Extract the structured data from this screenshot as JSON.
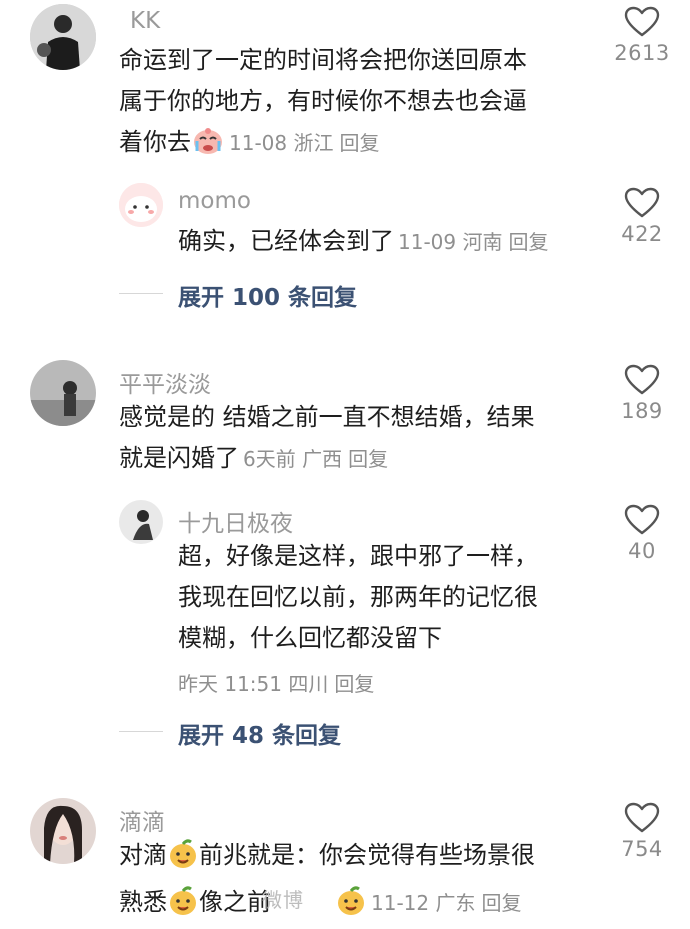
{
  "comments": [
    {
      "user": "KK",
      "text_lines": [
        "命运到了一定的时间将会把你送回原本",
        "属于你的地方，有时候你不想去也会逼",
        "着你去"
      ],
      "date": "11-08",
      "location": "浙江",
      "reply_label": "回复",
      "likes": "2613",
      "emoji": "crying-face",
      "replies": [
        {
          "user": "momo",
          "text": "确实，已经体会到了",
          "date": "11-09",
          "location": "河南",
          "reply_label": "回复",
          "likes": "422"
        }
      ],
      "expand_label": "展开 100 条回复"
    },
    {
      "user": "平平淡淡",
      "text_lines": [
        "感觉是的 结婚之前一直不想结婚，结果",
        "就是闪婚了"
      ],
      "date": "6天前",
      "location": "广西",
      "reply_label": "回复",
      "likes": "189",
      "replies": [
        {
          "user": "十九日极夜",
          "text_lines": [
            "超，好像是这样，跟中邪了一样，",
            "我现在回忆以前，那两年的记忆很",
            "模糊，什么回忆都没留下"
          ],
          "date": "昨天 11:51",
          "location": "四川",
          "reply_label": "回复",
          "likes": "40"
        }
      ],
      "expand_label": "展开 48 条回复"
    },
    {
      "user": "滴滴",
      "text_line1_a": "对滴",
      "text_line1_b": "前兆就是：你会觉得有些场景很",
      "text_line2_a": "熟悉",
      "text_line2_b": "像之前",
      "date": "11-12",
      "location": "广东",
      "reply_label": "回复",
      "likes": "754",
      "emoji": "mango-face"
    }
  ],
  "watermark": "微博"
}
